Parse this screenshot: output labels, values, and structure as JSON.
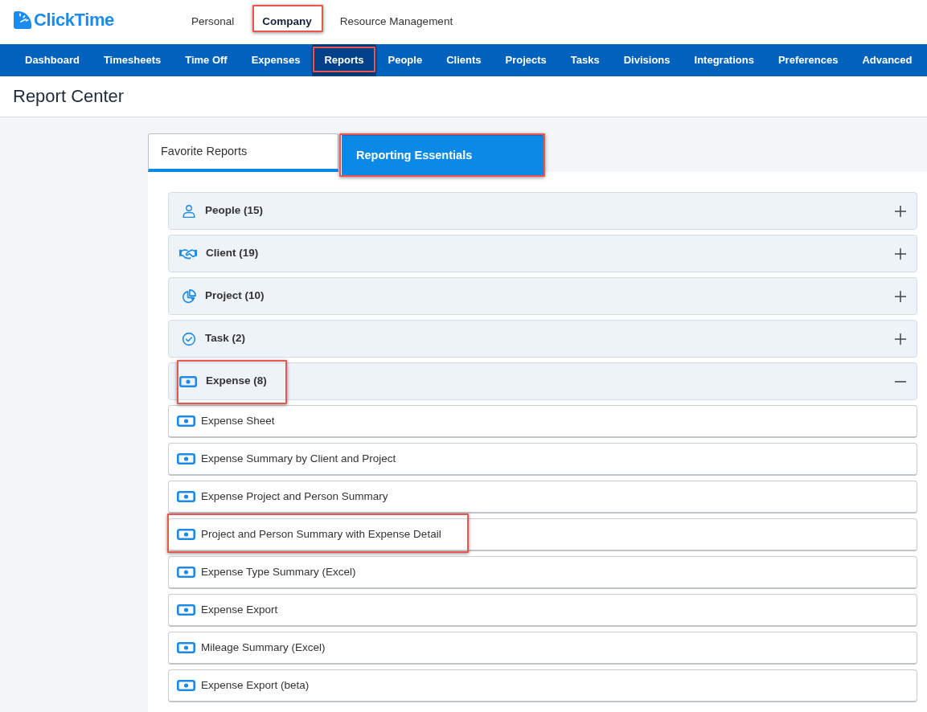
{
  "logo": {
    "text": "ClickTime"
  },
  "top_nav": [
    {
      "label": "Personal",
      "selected": false,
      "highlighted": false
    },
    {
      "label": "Company",
      "selected": true,
      "highlighted": true
    },
    {
      "label": "Resource Management",
      "selected": false,
      "highlighted": false
    }
  ],
  "main_nav": [
    {
      "label": "Dashboard",
      "selected": false,
      "highlighted": false
    },
    {
      "label": "Timesheets",
      "selected": false,
      "highlighted": false
    },
    {
      "label": "Time Off",
      "selected": false,
      "highlighted": false
    },
    {
      "label": "Expenses",
      "selected": false,
      "highlighted": false
    },
    {
      "label": "Reports",
      "selected": true,
      "highlighted": true
    },
    {
      "label": "People",
      "selected": false,
      "highlighted": false
    },
    {
      "label": "Clients",
      "selected": false,
      "highlighted": false
    },
    {
      "label": "Projects",
      "selected": false,
      "highlighted": false
    },
    {
      "label": "Tasks",
      "selected": false,
      "highlighted": false
    },
    {
      "label": "Divisions",
      "selected": false,
      "highlighted": false
    },
    {
      "label": "Integrations",
      "selected": false,
      "highlighted": false
    },
    {
      "label": "Preferences",
      "selected": false,
      "highlighted": false
    },
    {
      "label": "Advanced",
      "selected": false,
      "highlighted": false
    }
  ],
  "page_title": "Report Center",
  "tabs": [
    {
      "label": "Favorite Reports",
      "selected": false,
      "highlighted": false
    },
    {
      "label": "Reporting Essentials",
      "selected": true,
      "highlighted": true
    }
  ],
  "sections": [
    {
      "kind": "people",
      "label": "People (15)",
      "expanded": false,
      "highlighted": false
    },
    {
      "kind": "client",
      "label": "Client (19)",
      "expanded": false,
      "highlighted": false
    },
    {
      "kind": "project",
      "label": "Project (10)",
      "expanded": false,
      "highlighted": false
    },
    {
      "kind": "task",
      "label": "Task (2)",
      "expanded": false,
      "highlighted": false
    },
    {
      "kind": "expense",
      "label": "Expense (8)",
      "expanded": true,
      "highlighted": true,
      "reports": [
        {
          "label": "Expense Sheet",
          "highlighted": false
        },
        {
          "label": "Expense Summary by Client and Project",
          "highlighted": false
        },
        {
          "label": "Expense Project and Person Summary",
          "highlighted": false
        },
        {
          "label": "Project and Person Summary with Expense Detail",
          "highlighted": true
        },
        {
          "label": "Expense Type Summary (Excel)",
          "highlighted": false
        },
        {
          "label": "Expense Export",
          "highlighted": false
        },
        {
          "label": "Mileage Summary (Excel)",
          "highlighted": false
        },
        {
          "label": "Expense Export (beta)",
          "highlighted": false
        }
      ]
    }
  ]
}
